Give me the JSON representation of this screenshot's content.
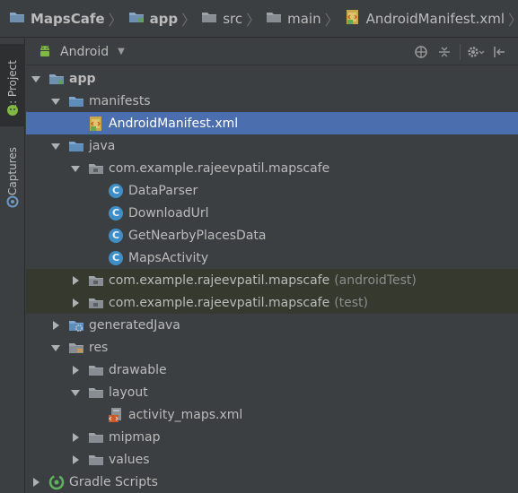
{
  "breadcrumb": {
    "project": "MapsCafe",
    "module": "app",
    "dir1": "src",
    "dir2": "main",
    "file": "AndroidManifest.xml"
  },
  "sidebar": {
    "project_tab": "1: Project",
    "captures_tab": "Captures"
  },
  "panel": {
    "view_mode": "Android"
  },
  "tree": {
    "app": "app",
    "manifests": "manifests",
    "manifest_file": "AndroidManifest.xml",
    "java": "java",
    "pkg_main": "com.example.rajeevpatil.mapscafe",
    "classes": [
      "DataParser",
      "DownloadUrl",
      "GetNearbyPlacesData",
      "MapsActivity"
    ],
    "pkg_android_test": "com.example.rajeevpatil.mapscafe",
    "pkg_android_test_suffix": "(androidTest)",
    "pkg_test": "com.example.rajeevpatil.mapscafe",
    "pkg_test_suffix": "(test)",
    "generated_java": "generatedJava",
    "res": "res",
    "drawable": "drawable",
    "layout": "layout",
    "layout_file": "activity_maps.xml",
    "mipmap": "mipmap",
    "values": "values",
    "gradle": "Gradle Scripts"
  },
  "colors": {
    "background": "#3c3f41",
    "selection": "#4b6eaf",
    "test_highlight": "#36392e",
    "folder_blue": "#6f98c0",
    "class_badge": "#3f8fc6"
  }
}
